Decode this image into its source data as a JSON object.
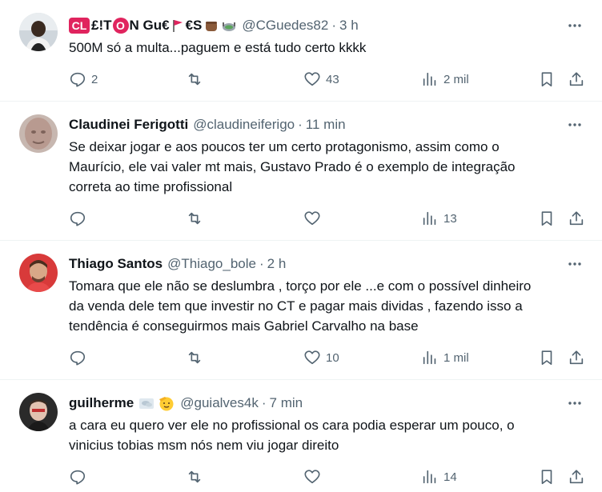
{
  "tweets": [
    {
      "name_parts": [
        "CL",
        "£!T",
        "O",
        "N Gu€ ",
        "€S"
      ],
      "handle": "@CGuedes82",
      "sep": "·",
      "time": "3 h",
      "text": "500M só a multa...paguem e está tudo certo kkkk",
      "replies": "2",
      "retweets": "",
      "likes": "43",
      "views": "2 mil"
    },
    {
      "name": "Claudinei Ferigotti",
      "handle": "@claudineiferigo",
      "sep": "·",
      "time": "11 min",
      "text_lines": [
        "Se deixar jogar e aos poucos ter um certo protagonismo, assim como o",
        "Maurício, ele vai valer mt mais, Gustavo Prado é o exemplo de integração",
        "correta ao time profissional"
      ],
      "replies": "",
      "retweets": "",
      "likes": "",
      "views": "13"
    },
    {
      "name": "Thiago Santos",
      "handle": "@Thiago_bole",
      "sep": "·",
      "time": "2 h",
      "text_lines": [
        "Tomara que ele não se deslumbra , torço por ele ...e com o possível dinheiro",
        "da venda dele tem que investir no CT e pagar mais dividas , fazendo isso a",
        "tendência é conseguirmos mais Gabriel Carvalho na base"
      ],
      "replies": "",
      "retweets": "",
      "likes": "10",
      "views": "1 mil"
    },
    {
      "name": "guilherme",
      "handle": "@guialves4k",
      "sep": "·",
      "time": "7 min",
      "text_lines": [
        "a cara eu quero ver ele no profissional os cara podia esperar um pouco, o",
        "vinicius tobias msm nós nem viu jogar direito"
      ],
      "replies": "",
      "retweets": "",
      "likes": "",
      "views": "14"
    }
  ],
  "icons": {
    "reply": "reply-icon",
    "retweet": "retweet-icon",
    "like": "like-icon",
    "views": "views-icon",
    "bookmark": "bookmark-icon",
    "share": "share-icon",
    "more": "more-icon"
  },
  "colors": {
    "text": "#0f1419",
    "muted": "#536471",
    "badge_red": "#e0245e",
    "divider": "#eff3f4"
  }
}
